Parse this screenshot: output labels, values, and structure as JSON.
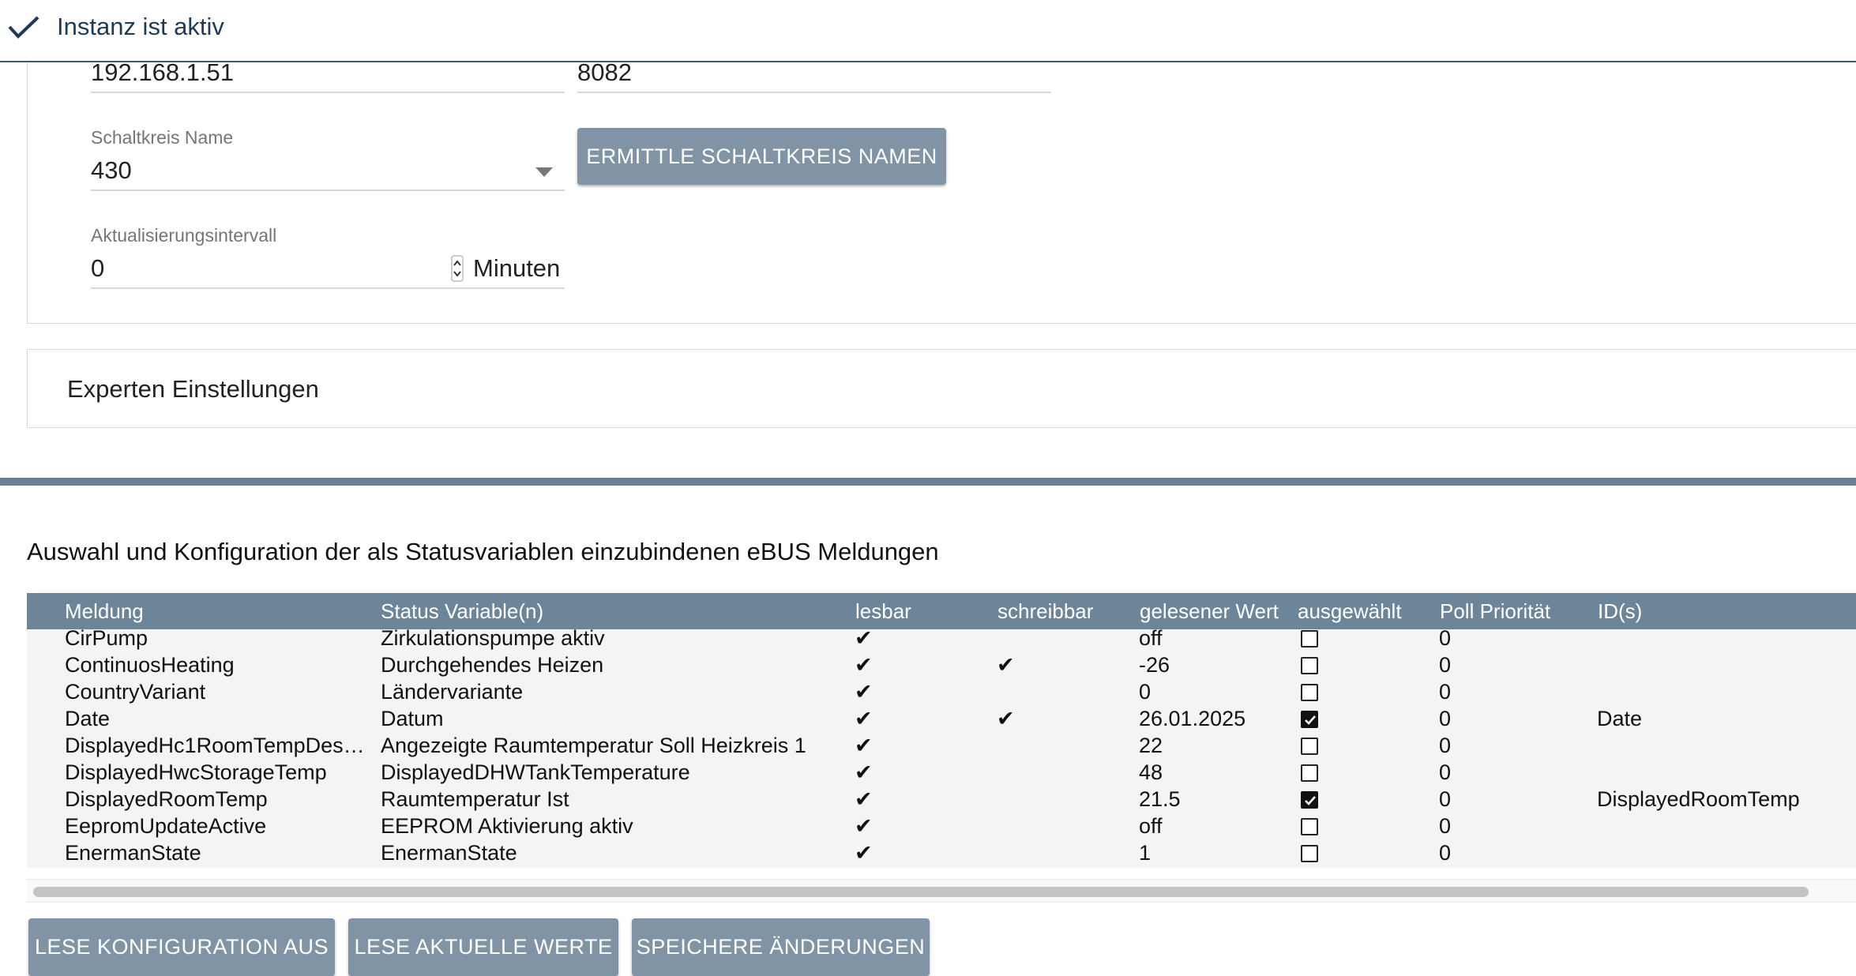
{
  "status": {
    "text": "Instanz ist aktiv",
    "icon": "check-icon"
  },
  "config": {
    "host_value": "192.168.1.51",
    "port_value": "8082",
    "circuit_label": "Schaltkreis Name",
    "circuit_value": "430",
    "determine_button": "ERMITTLE SCHALTKREIS NAMEN",
    "interval_label": "Aktualisierungsintervall",
    "interval_value": "0",
    "interval_unit": "Minuten"
  },
  "expert": {
    "title": "Experten Einstellungen"
  },
  "messages": {
    "title": "Auswahl und Konfiguration der als Statusvariablen einzubindenen eBUS Meldungen",
    "columns": [
      "Meldung",
      "Status Variable(n)",
      "lesbar",
      "schreibbar",
      "gelesener Wert",
      "ausgewählt",
      "Poll Priorität",
      "ID(s)"
    ],
    "check_mark": "✔",
    "rows": [
      {
        "name": "CirPump",
        "variable": "Zirkulationspumpe aktiv",
        "readable": true,
        "writable": false,
        "value": "off",
        "selected": false,
        "priority": "0",
        "ids": ""
      },
      {
        "name": "ContinuosHeating",
        "variable": "Durchgehendes Heizen",
        "readable": true,
        "writable": true,
        "value": "-26",
        "selected": false,
        "priority": "0",
        "ids": ""
      },
      {
        "name": "CountryVariant",
        "variable": "Ländervariante",
        "readable": true,
        "writable": false,
        "value": "0",
        "selected": false,
        "priority": "0",
        "ids": ""
      },
      {
        "name": "Date",
        "variable": "Datum",
        "readable": true,
        "writable": true,
        "value": "26.01.2025",
        "selected": true,
        "priority": "0",
        "ids": "Date"
      },
      {
        "name": "DisplayedHc1RoomTempDes…",
        "variable": "Angezeigte Raumtemperatur Soll Heizkreis 1",
        "readable": true,
        "writable": false,
        "value": "22",
        "selected": false,
        "priority": "0",
        "ids": ""
      },
      {
        "name": "DisplayedHwcStorageTemp",
        "variable": "DisplayedDHWTankTemperature",
        "readable": true,
        "writable": false,
        "value": "48",
        "selected": false,
        "priority": "0",
        "ids": ""
      },
      {
        "name": "DisplayedRoomTemp",
        "variable": "Raumtemperatur Ist",
        "readable": true,
        "writable": false,
        "value": "21.5",
        "selected": true,
        "priority": "0",
        "ids": "DisplayedRoomTemp"
      },
      {
        "name": "EepromUpdateActive",
        "variable": "EEPROM Aktivierung aktiv",
        "readable": true,
        "writable": false,
        "value": "off",
        "selected": false,
        "priority": "0",
        "ids": ""
      },
      {
        "name": "EnermanState",
        "variable": "EnermanState",
        "readable": true,
        "writable": false,
        "value": "1",
        "selected": false,
        "priority": "0",
        "ids": ""
      }
    ]
  },
  "actions": {
    "read_config": "LESE KONFIGURATION AUS",
    "read_values": "LESE AKTUELLE WERTE",
    "save_changes": "SPEICHERE ÄNDERUNGEN"
  },
  "colors": {
    "button": "#8094a6",
    "table_header": "#6d8599",
    "divider": "#6b8196",
    "status_text": "#1e3a56"
  }
}
